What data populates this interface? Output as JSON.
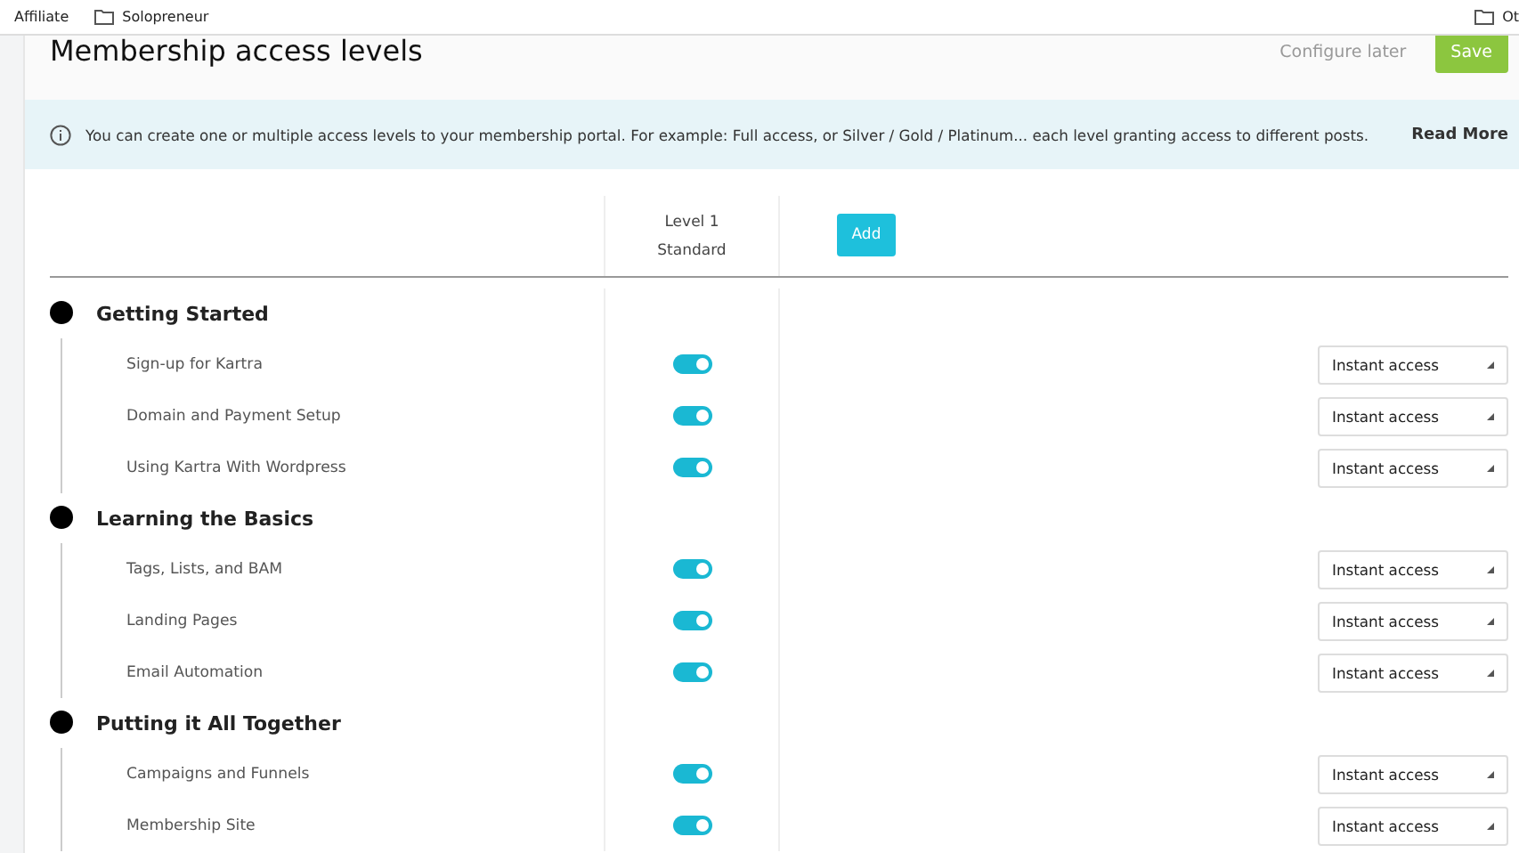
{
  "bookmarks": [
    {
      "label": "Affiliate"
    },
    {
      "label": "Solopreneur"
    }
  ],
  "bookmarks_right": {
    "label": "Ot"
  },
  "header": {
    "title": "Membership access levels",
    "secondary_action": "Configure later",
    "primary_action": "Save"
  },
  "info": {
    "text": "You can create one or multiple access levels to your membership portal. For example: Full access, or Silver / Gold / Platinum... each level granting access to different posts.",
    "link": "Read More"
  },
  "levels": [
    {
      "name": "Level 1",
      "type": "Standard"
    }
  ],
  "add_button": "Add",
  "sections": [
    {
      "title": "Getting Started",
      "items": [
        {
          "name": "Sign-up for Kartra",
          "on": true,
          "access": "Instant access"
        },
        {
          "name": "Domain and Payment Setup",
          "on": true,
          "access": "Instant access"
        },
        {
          "name": "Using Kartra With Wordpress",
          "on": true,
          "access": "Instant access"
        }
      ]
    },
    {
      "title": "Learning the Basics",
      "items": [
        {
          "name": "Tags, Lists, and BAM",
          "on": true,
          "access": "Instant access"
        },
        {
          "name": "Landing Pages",
          "on": true,
          "access": "Instant access"
        },
        {
          "name": "Email Automation",
          "on": true,
          "access": "Instant access"
        }
      ]
    },
    {
      "title": "Putting it All Together",
      "items": [
        {
          "name": "Campaigns and Funnels",
          "on": true,
          "access": "Instant access"
        },
        {
          "name": "Membership Site",
          "on": true,
          "access": "Instant access"
        }
      ]
    }
  ]
}
